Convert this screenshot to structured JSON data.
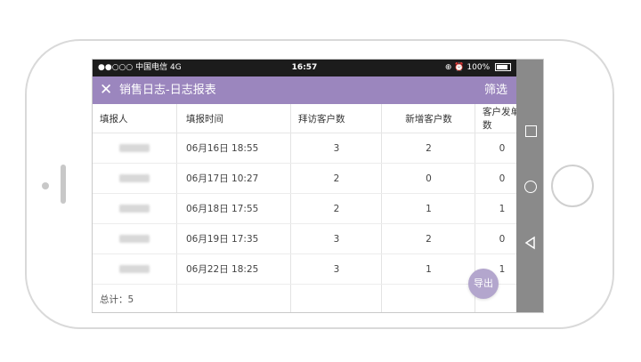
{
  "status_bar": {
    "carrier": "●●○○○ 中国电信  4G",
    "time": "16:57",
    "battery": "100%"
  },
  "header": {
    "close_icon": "close-icon",
    "title": "销售日志-日志报表",
    "filter_label": "筛选"
  },
  "table": {
    "columns": [
      "填报人",
      "填报时间",
      "拜访客户数",
      "新增客户数",
      "客户发单数"
    ],
    "rows": [
      {
        "time": "06月16日  18:55",
        "visits": "3",
        "new_customers": "2",
        "orders": "0"
      },
      {
        "time": "06月17日  10:27",
        "visits": "2",
        "new_customers": "0",
        "orders": "0"
      },
      {
        "time": "06月18日  17:55",
        "visits": "2",
        "new_customers": "1",
        "orders": "1"
      },
      {
        "time": "06月19日  17:35",
        "visits": "3",
        "new_customers": "2",
        "orders": "0"
      },
      {
        "time": "06月22日  18:25",
        "visits": "3",
        "new_customers": "1",
        "orders": "1"
      }
    ],
    "footer": "总计：5"
  },
  "export_label": "导出",
  "android_nav": {
    "square_icon": "recent-apps-icon",
    "circle_icon": "home-icon",
    "back_icon": "back-icon"
  }
}
